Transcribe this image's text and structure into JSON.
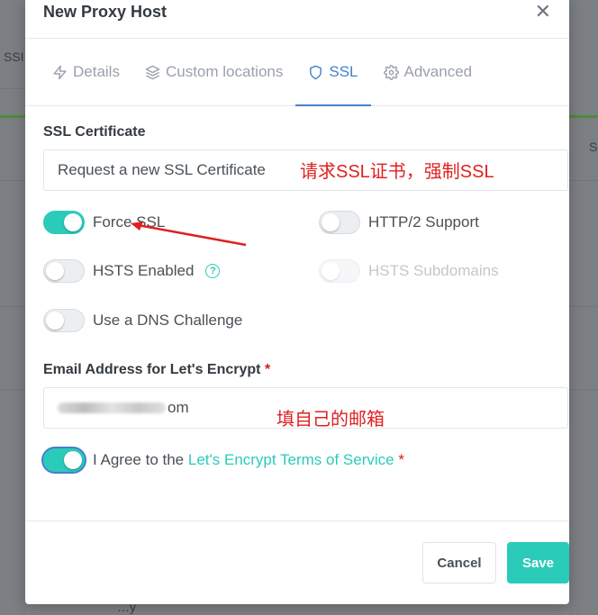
{
  "background": {
    "fragment_left": "SSI",
    "fragment_right": "S",
    "fragment_bottom": "…y"
  },
  "modal": {
    "title": "New Proxy Host",
    "close_glyph": "✕"
  },
  "tabs": [
    {
      "label": "Details",
      "icon": "lightning-icon",
      "active": false
    },
    {
      "label": "Custom locations",
      "icon": "layers-icon",
      "active": false
    },
    {
      "label": "SSL",
      "icon": "shield-icon",
      "active": true
    },
    {
      "label": "Advanced",
      "icon": "gear-icon",
      "active": false
    }
  ],
  "ssl": {
    "certificate_label": "SSL Certificate",
    "certificate_value": "Request a new SSL Certificate",
    "annotation_cert": "请求SSL证书，强制SSL",
    "switches": {
      "force_ssl": {
        "label": "Force SSL",
        "on": true
      },
      "http2": {
        "label": "HTTP/2 Support",
        "on": false
      },
      "hsts": {
        "label": "HSTS Enabled",
        "on": false,
        "help_glyph": "?"
      },
      "hsts_sub": {
        "label": "HSTS Subdomains",
        "on": false,
        "disabled": true
      },
      "dns": {
        "label": "Use a DNS Challenge",
        "on": false
      }
    },
    "email_label": "Email Address for Let's Encrypt",
    "required_mark": "*",
    "email_value_suffix": "om",
    "annotation_email": "填自己的邮箱",
    "agree_prefix": "I Agree to the",
    "agree_link": "Let's Encrypt Terms of Service",
    "agree_on": true
  },
  "footer": {
    "cancel_label": "Cancel",
    "save_label": "Save"
  },
  "colors": {
    "accent": "#467fcf",
    "teal": "#2bcbba",
    "annotation": "#e02020",
    "required": "#cd201f"
  }
}
